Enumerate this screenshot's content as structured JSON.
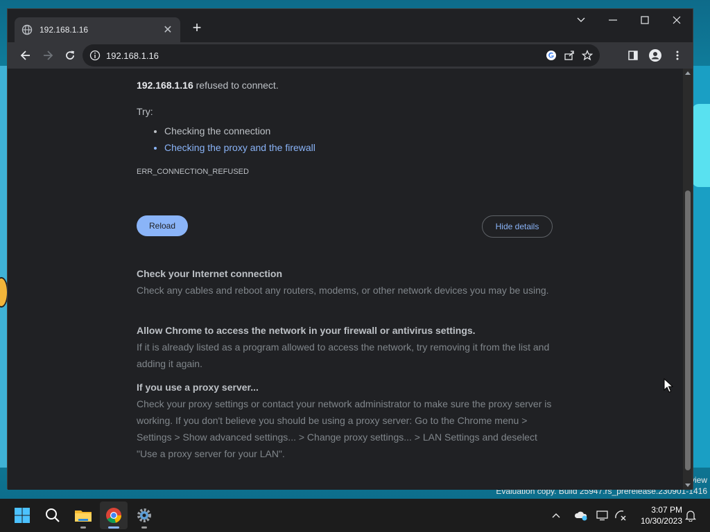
{
  "browser": {
    "tab_title": "192.168.1.16",
    "url": "192.168.1.16"
  },
  "error_page": {
    "host": "192.168.1.16",
    "refused_text": " refused to connect.",
    "try_label": "Try:",
    "suggestions": [
      "Checking the connection",
      "Checking the proxy and the firewall"
    ],
    "error_code": "ERR_CONNECTION_REFUSED",
    "reload_label": "Reload",
    "hide_details_label": "Hide details",
    "sections": [
      {
        "heading": "Check your Internet connection",
        "body": "Check any cables and reboot any routers, modems, or other network devices you may be using."
      },
      {
        "heading": "Allow Chrome to access the network in your firewall or antivirus settings.",
        "body": "If it is already listed as a program allowed to access the network, try removing it from the list and adding it again."
      },
      {
        "heading": "If you use a proxy server...",
        "body": "Check your proxy settings or contact your network administrator to make sure the proxy server is working. If you don't believe you should be using a proxy server: Go to the Chrome menu > Settings > Show advanced settings... > Change proxy settings... > LAN Settings and deselect \"Use a proxy server for your LAN\"."
      }
    ]
  },
  "desktop": {
    "watermark_tail": "view",
    "watermark": "Evaluation copy. Build 25947.rs_prerelease.230901-1416"
  },
  "taskbar": {
    "time": "3:07 PM",
    "date": "10/30/2023"
  },
  "colors": {
    "link": "#8ab4f8",
    "page_bg": "#202124",
    "toolbar_bg": "#35363a"
  },
  "icons": [
    "globe-icon",
    "close-icon",
    "plus-icon",
    "chevron-down-icon",
    "minimize-icon",
    "maximize-icon",
    "back-icon",
    "forward-icon",
    "reload-icon",
    "info-icon",
    "google-icon",
    "share-icon",
    "star-icon",
    "side-panel-icon",
    "profile-icon",
    "kebab-menu-icon",
    "windows-start-icon",
    "search-icon",
    "file-explorer-icon",
    "chrome-icon",
    "settings-icon",
    "chevron-up-icon",
    "onedrive-icon",
    "display-icon",
    "network-icon",
    "notification-bell-icon",
    "mouse-pointer-icon"
  ]
}
